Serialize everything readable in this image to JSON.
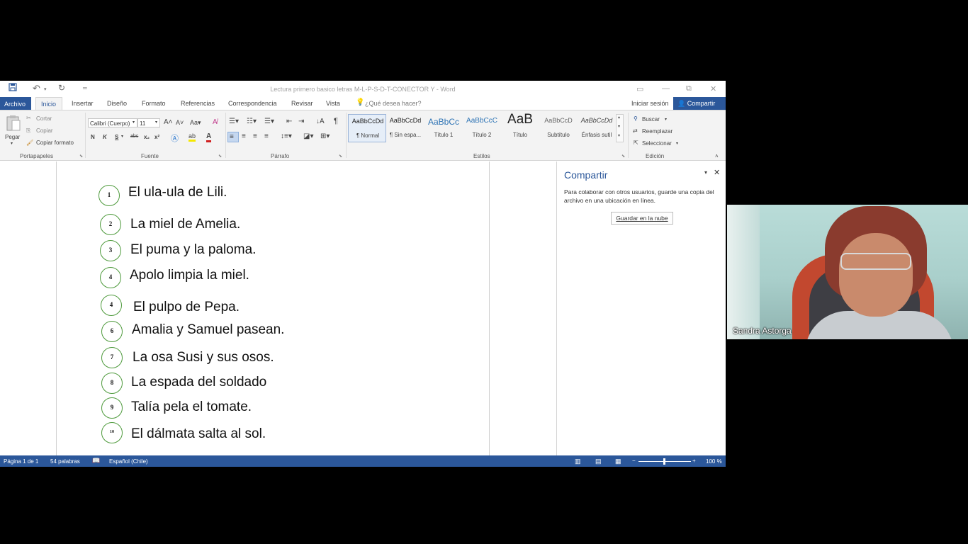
{
  "window": {
    "title": "Lectura primero basico letras M-L-P-S-D-T-CONECTOR Y - Word"
  },
  "menu": {
    "archivo": "Archivo",
    "inicio": "Inicio",
    "insertar": "Insertar",
    "diseno": "Diseño",
    "formato": "Formato",
    "referencias": "Referencias",
    "correspondencia": "Correspondencia",
    "revisar": "Revisar",
    "vista": "Vista",
    "search_placeholder": "¿Qué desea hacer?",
    "signin": "Iniciar sesión",
    "share": "Compartir"
  },
  "ribbon": {
    "clipboard": {
      "paste": "Pegar",
      "cut": "Cortar",
      "copy": "Copiar",
      "format_painter": "Copiar formato",
      "label": "Portapapeles"
    },
    "font": {
      "name": "Calibri (Cuerpo)",
      "size": "11",
      "label": "Fuente"
    },
    "paragraph": {
      "label": "Párrafo"
    },
    "styles": {
      "items": [
        {
          "preview": "AaBbCcDd",
          "name": "¶ Normal"
        },
        {
          "preview": "AaBbCcDd",
          "name": "¶ Sin espa..."
        },
        {
          "preview": "AaBbCc",
          "name": "Título 1"
        },
        {
          "preview": "AaBbCcC",
          "name": "Título 2"
        },
        {
          "preview": "AaB",
          "name": "Título"
        },
        {
          "preview": "AaBbCcD",
          "name": "Subtítulo"
        },
        {
          "preview": "AaBbCcDd",
          "name": "Énfasis sutil"
        }
      ],
      "label": "Estilos"
    },
    "editing": {
      "find": "Buscar",
      "replace": "Reemplazar",
      "select": "Seleccionar",
      "label": "Edición"
    }
  },
  "document": {
    "lines": [
      {
        "num": "1",
        "text": "El ula-ula de Lili."
      },
      {
        "num": "2",
        "text": "La miel de Amelia."
      },
      {
        "num": "3",
        "text": "El puma y la paloma."
      },
      {
        "num": "4",
        "text": "Apolo limpia la miel."
      },
      {
        "num": "4",
        "text": "El pulpo de Pepa."
      },
      {
        "num": "6",
        "text": "Amalia y Samuel pasean."
      },
      {
        "num": "7",
        "text": "La osa Susi y sus osos."
      },
      {
        "num": "8",
        "text": "La espada del soldado"
      },
      {
        "num": "9",
        "text": "Talía pela el tomate."
      },
      {
        "num": "10",
        "text": "El dálmata salta al sol."
      }
    ]
  },
  "share_pane": {
    "title": "Compartir",
    "description": "Para colaborar con otros usuarios, guarde una copia del archivo en una ubicación en línea.",
    "button": "Guardar en la nube"
  },
  "status": {
    "page": "Página 1 de 1",
    "words": "54 palabras",
    "language": "Español (Chile)",
    "zoom": "100 %"
  },
  "video": {
    "participant": "Sandra Astorga"
  },
  "colors": {
    "accent": "#2b579a",
    "circle": "#4e9a3c"
  }
}
